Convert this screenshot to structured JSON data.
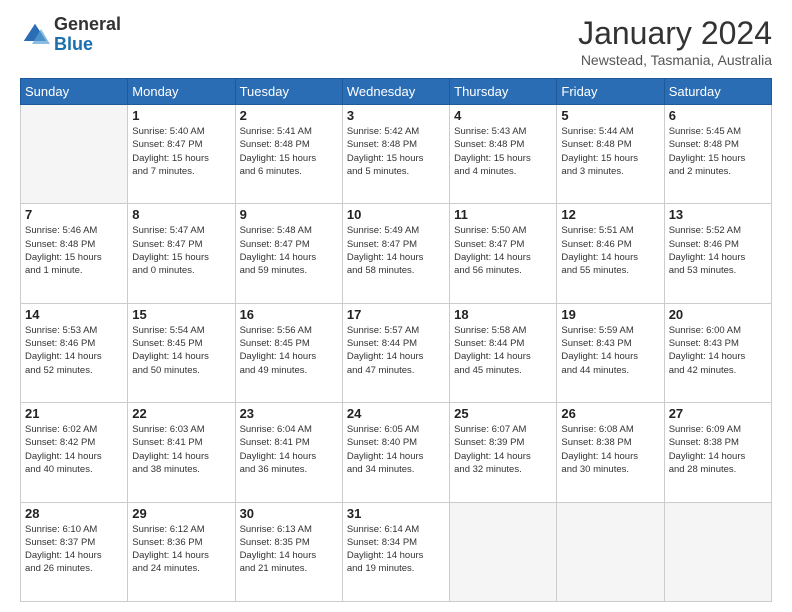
{
  "logo": {
    "general": "General",
    "blue": "Blue"
  },
  "title": "January 2024",
  "location": "Newstead, Tasmania, Australia",
  "days_header": [
    "Sunday",
    "Monday",
    "Tuesday",
    "Wednesday",
    "Thursday",
    "Friday",
    "Saturday"
  ],
  "weeks": [
    [
      {
        "day": "",
        "info": ""
      },
      {
        "day": "1",
        "info": "Sunrise: 5:40 AM\nSunset: 8:47 PM\nDaylight: 15 hours\nand 7 minutes."
      },
      {
        "day": "2",
        "info": "Sunrise: 5:41 AM\nSunset: 8:48 PM\nDaylight: 15 hours\nand 6 minutes."
      },
      {
        "day": "3",
        "info": "Sunrise: 5:42 AM\nSunset: 8:48 PM\nDaylight: 15 hours\nand 5 minutes."
      },
      {
        "day": "4",
        "info": "Sunrise: 5:43 AM\nSunset: 8:48 PM\nDaylight: 15 hours\nand 4 minutes."
      },
      {
        "day": "5",
        "info": "Sunrise: 5:44 AM\nSunset: 8:48 PM\nDaylight: 15 hours\nand 3 minutes."
      },
      {
        "day": "6",
        "info": "Sunrise: 5:45 AM\nSunset: 8:48 PM\nDaylight: 15 hours\nand 2 minutes."
      }
    ],
    [
      {
        "day": "7",
        "info": "Sunrise: 5:46 AM\nSunset: 8:48 PM\nDaylight: 15 hours\nand 1 minute."
      },
      {
        "day": "8",
        "info": "Sunrise: 5:47 AM\nSunset: 8:47 PM\nDaylight: 15 hours\nand 0 minutes."
      },
      {
        "day": "9",
        "info": "Sunrise: 5:48 AM\nSunset: 8:47 PM\nDaylight: 14 hours\nand 59 minutes."
      },
      {
        "day": "10",
        "info": "Sunrise: 5:49 AM\nSunset: 8:47 PM\nDaylight: 14 hours\nand 58 minutes."
      },
      {
        "day": "11",
        "info": "Sunrise: 5:50 AM\nSunset: 8:47 PM\nDaylight: 14 hours\nand 56 minutes."
      },
      {
        "day": "12",
        "info": "Sunrise: 5:51 AM\nSunset: 8:46 PM\nDaylight: 14 hours\nand 55 minutes."
      },
      {
        "day": "13",
        "info": "Sunrise: 5:52 AM\nSunset: 8:46 PM\nDaylight: 14 hours\nand 53 minutes."
      }
    ],
    [
      {
        "day": "14",
        "info": "Sunrise: 5:53 AM\nSunset: 8:46 PM\nDaylight: 14 hours\nand 52 minutes."
      },
      {
        "day": "15",
        "info": "Sunrise: 5:54 AM\nSunset: 8:45 PM\nDaylight: 14 hours\nand 50 minutes."
      },
      {
        "day": "16",
        "info": "Sunrise: 5:56 AM\nSunset: 8:45 PM\nDaylight: 14 hours\nand 49 minutes."
      },
      {
        "day": "17",
        "info": "Sunrise: 5:57 AM\nSunset: 8:44 PM\nDaylight: 14 hours\nand 47 minutes."
      },
      {
        "day": "18",
        "info": "Sunrise: 5:58 AM\nSunset: 8:44 PM\nDaylight: 14 hours\nand 45 minutes."
      },
      {
        "day": "19",
        "info": "Sunrise: 5:59 AM\nSunset: 8:43 PM\nDaylight: 14 hours\nand 44 minutes."
      },
      {
        "day": "20",
        "info": "Sunrise: 6:00 AM\nSunset: 8:43 PM\nDaylight: 14 hours\nand 42 minutes."
      }
    ],
    [
      {
        "day": "21",
        "info": "Sunrise: 6:02 AM\nSunset: 8:42 PM\nDaylight: 14 hours\nand 40 minutes."
      },
      {
        "day": "22",
        "info": "Sunrise: 6:03 AM\nSunset: 8:41 PM\nDaylight: 14 hours\nand 38 minutes."
      },
      {
        "day": "23",
        "info": "Sunrise: 6:04 AM\nSunset: 8:41 PM\nDaylight: 14 hours\nand 36 minutes."
      },
      {
        "day": "24",
        "info": "Sunrise: 6:05 AM\nSunset: 8:40 PM\nDaylight: 14 hours\nand 34 minutes."
      },
      {
        "day": "25",
        "info": "Sunrise: 6:07 AM\nSunset: 8:39 PM\nDaylight: 14 hours\nand 32 minutes."
      },
      {
        "day": "26",
        "info": "Sunrise: 6:08 AM\nSunset: 8:38 PM\nDaylight: 14 hours\nand 30 minutes."
      },
      {
        "day": "27",
        "info": "Sunrise: 6:09 AM\nSunset: 8:38 PM\nDaylight: 14 hours\nand 28 minutes."
      }
    ],
    [
      {
        "day": "28",
        "info": "Sunrise: 6:10 AM\nSunset: 8:37 PM\nDaylight: 14 hours\nand 26 minutes."
      },
      {
        "day": "29",
        "info": "Sunrise: 6:12 AM\nSunset: 8:36 PM\nDaylight: 14 hours\nand 24 minutes."
      },
      {
        "day": "30",
        "info": "Sunrise: 6:13 AM\nSunset: 8:35 PM\nDaylight: 14 hours\nand 21 minutes."
      },
      {
        "day": "31",
        "info": "Sunrise: 6:14 AM\nSunset: 8:34 PM\nDaylight: 14 hours\nand 19 minutes."
      },
      {
        "day": "",
        "info": ""
      },
      {
        "day": "",
        "info": ""
      },
      {
        "day": "",
        "info": ""
      }
    ]
  ]
}
